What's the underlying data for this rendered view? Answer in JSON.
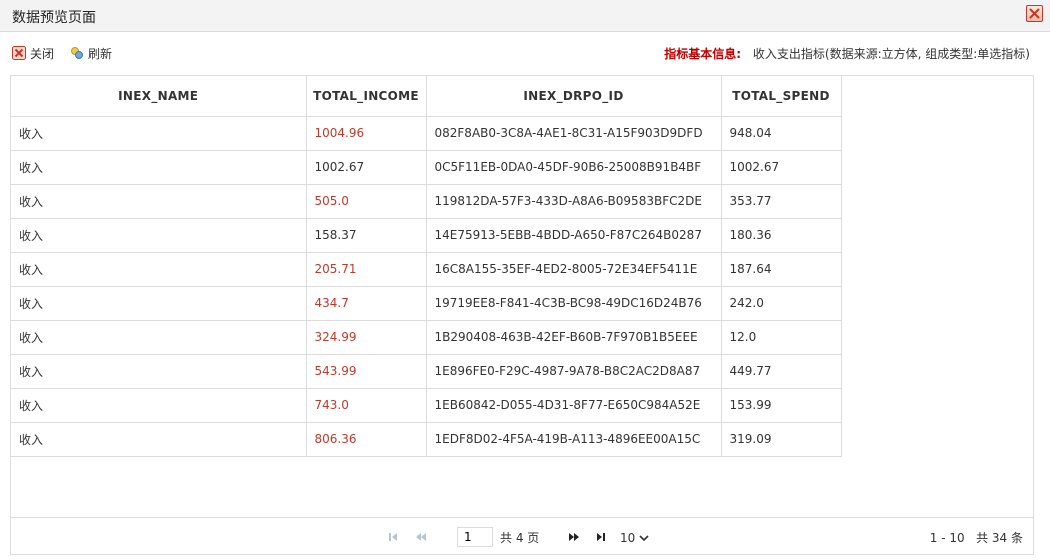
{
  "window": {
    "title": "数据预览页面"
  },
  "toolbar": {
    "close_label": "关闭",
    "refresh_label": "刷新"
  },
  "info": {
    "label": "指标基本信息:",
    "value": "收入支出指标(数据来源:立方体, 组成类型:单选指标)"
  },
  "table": {
    "columns": [
      "INEX_NAME",
      "TOTAL_INCOME",
      "INEX_DRPO_ID",
      "TOTAL_SPEND"
    ],
    "rows": [
      [
        "收入",
        "1004.96",
        "082F8AB0-3C8A-4AE1-8C31-A15F903D9DFD",
        "948.04"
      ],
      [
        "收入",
        "1002.67",
        "0C5F11EB-0DA0-45DF-90B6-25008B91B4BF",
        "1002.67"
      ],
      [
        "收入",
        "505.0",
        "119812DA-57F3-433D-A8A6-B09583BFC2DE",
        "353.77"
      ],
      [
        "收入",
        "158.37",
        "14E75913-5EBB-4BDD-A650-F87C264B0287",
        "180.36"
      ],
      [
        "收入",
        "205.71",
        "16C8A155-35EF-4ED2-8005-72E34EF5411E",
        "187.64"
      ],
      [
        "收入",
        "434.7",
        "19719EE8-F841-4C3B-BC98-49DC16D24B76",
        "242.0"
      ],
      [
        "收入",
        "324.99",
        "1B290408-463B-42EF-B60B-7F970B1B5EEE",
        "12.0"
      ],
      [
        "收入",
        "543.99",
        "1E896FE0-F29C-4987-9A78-B8C2AC2D8A87",
        "449.77"
      ],
      [
        "收入",
        "743.0",
        "1EB60842-D055-4D31-8F77-E650C984A52E",
        "153.99"
      ],
      [
        "收入",
        "806.36",
        "1EDF8D02-4F5A-419B-A113-4896EE00A15C",
        "319.09"
      ]
    ],
    "highlighted_income": [
      true,
      false,
      true,
      false,
      true,
      true,
      true,
      true,
      true,
      true
    ]
  },
  "pager": {
    "current_page": "1",
    "total_pages_text": "共 4 页",
    "page_size": "10",
    "range_text": "1 - 10   共 34 条"
  },
  "colors": {
    "highlight": "#c0392b",
    "label_red": "#c00000",
    "border": "#dcdcdc"
  }
}
